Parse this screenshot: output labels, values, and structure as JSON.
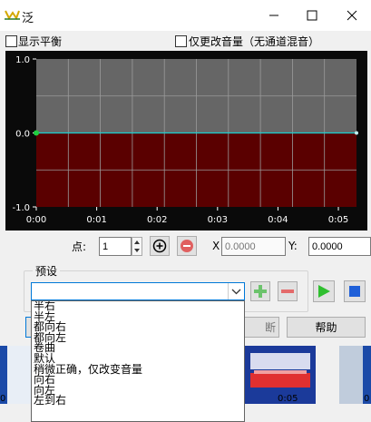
{
  "window": {
    "title": "泛"
  },
  "options": {
    "show_balance": "显示平衡",
    "change_volume_only": "仅更改音量（无通道混音）"
  },
  "chart_data": {
    "type": "line",
    "x_ticks": [
      "0:00",
      "0:01",
      "0:02",
      "0:03",
      "0:04",
      "0:05"
    ],
    "y_ticks": [
      "1.0",
      "0.0",
      "-1.0"
    ],
    "ylim": [
      -1.0,
      1.0
    ],
    "xlim_seconds": [
      0,
      5.3
    ],
    "series": [
      {
        "x": [
          0,
          5.3
        ],
        "y": [
          0.0,
          0.0
        ]
      }
    ],
    "colors": {
      "upper": "#666666",
      "lower": "#5a0000",
      "line": "#18d0d0",
      "grid": "#9a9a9a"
    }
  },
  "point_editor": {
    "point_label": "点:",
    "point_value": "1",
    "x_label": "X",
    "x_placeholder": "0.0000",
    "y_label": "Y:",
    "y_value": "0.0000"
  },
  "presets": {
    "group_label": "预设",
    "options": [
      "半右",
      "半左",
      "都向右",
      "都向左",
      "卷曲",
      "默认",
      "稍微正确，仅改变音量",
      "向右",
      "向左",
      "左到右"
    ]
  },
  "buttons": {
    "partial_label": "断",
    "help_label": "帮助"
  },
  "timeline": {
    "labels": [
      "0",
      "0:05",
      "0"
    ]
  },
  "colors": {
    "play": "#2fbf2f",
    "stop": "#1e5fd8",
    "add": "#6cc36c",
    "remove": "#e46a6a"
  }
}
